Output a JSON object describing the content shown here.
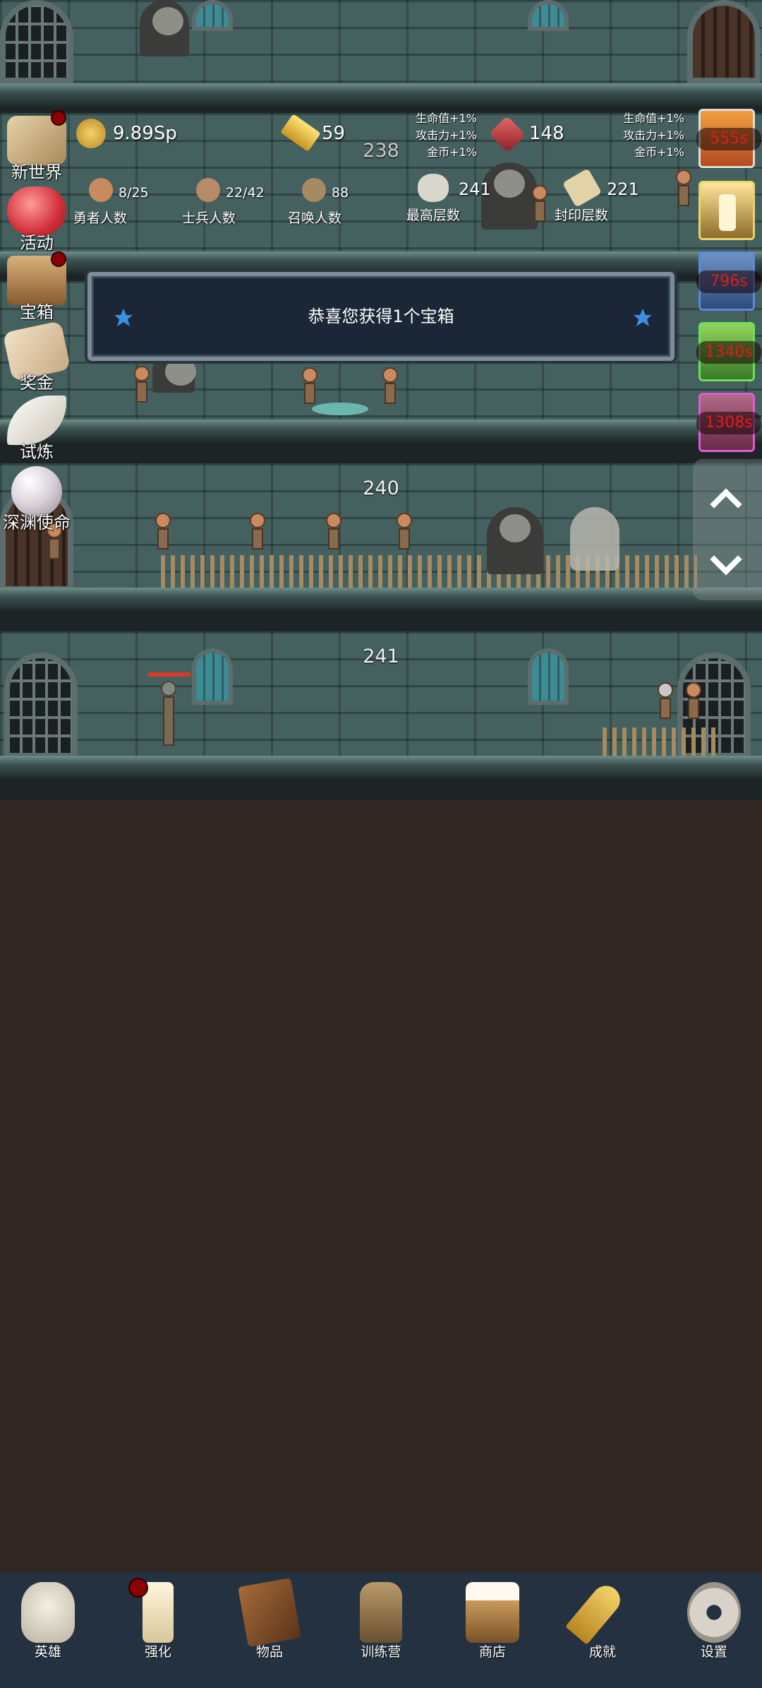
{
  "resources": {
    "gold": "9.89Sp",
    "gold_bar": "59",
    "gem": "148"
  },
  "buff_text": {
    "left": "生命值+1%\n攻击力+1%\n金币+1%",
    "right": "生命值+1%\n攻击力+1%\n金币+1%"
  },
  "counts": {
    "heroes_value": "8/25",
    "heroes_label": "勇者人数",
    "soldiers_value": "22/42",
    "soldiers_label": "士兵人数",
    "summons_value": "88",
    "summons_label": "召唤人数",
    "max_floor_value": "241",
    "max_floor_label": "最高层数",
    "sealed_floor_value": "221",
    "sealed_floor_label": "封印层数"
  },
  "floors": {
    "floor_238": "238",
    "floor_240": "240",
    "floor_241": "241"
  },
  "side_menu": [
    {
      "label": "新世界",
      "icon": "map-scroll-icon",
      "dot": true
    },
    {
      "label": "活动",
      "icon": "heart-icon",
      "dot": false
    },
    {
      "label": "宝箱",
      "icon": "treasure-chest-icon",
      "dot": true
    },
    {
      "label": "奖金",
      "icon": "envelope-icon",
      "dot": false
    },
    {
      "label": "试炼",
      "icon": "feather-icon",
      "dot": false
    },
    {
      "label": "深渊使命",
      "icon": "pearl-icon",
      "dot": false
    }
  ],
  "timers": [
    "555s",
    "",
    "796s",
    "1340s",
    "1308s"
  ],
  "toast": {
    "message": "恭喜您获得1个宝箱"
  },
  "nav": [
    {
      "label": "英雄",
      "icon": "skull-icon"
    },
    {
      "label": "强化",
      "icon": "candle-icon"
    },
    {
      "label": "物品",
      "icon": "book-icon"
    },
    {
      "label": "训练营",
      "icon": "lantern-icon"
    },
    {
      "label": "商店",
      "icon": "beer-mug-icon"
    },
    {
      "label": "成就",
      "icon": "key-icon"
    },
    {
      "label": "设置",
      "icon": "gear-icon"
    }
  ],
  "colors": {
    "background": "#302725",
    "navbar": "#243140",
    "timer_text": "#e21b1b",
    "notification_dot": "#8b0000"
  }
}
